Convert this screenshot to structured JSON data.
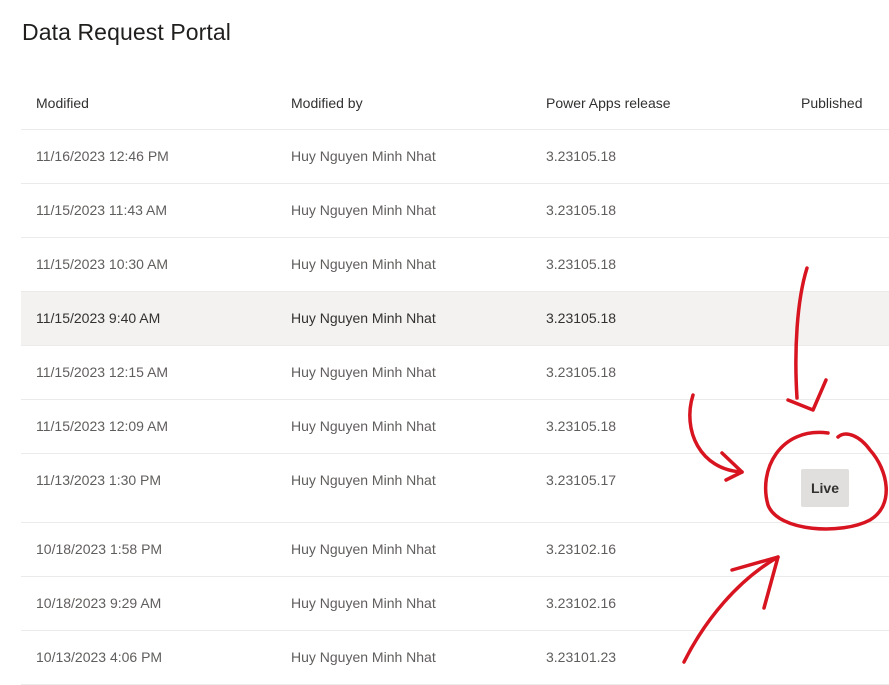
{
  "page": {
    "title": "Data Request Portal"
  },
  "table": {
    "columns": [
      "Modified",
      "Modified by",
      "Power Apps release",
      "Published"
    ],
    "rows": [
      {
        "modified": "11/16/2023 12:46 PM",
        "modified_by": "Huy Nguyen Minh Nhat",
        "release": "3.23105.18",
        "published": ""
      },
      {
        "modified": "11/15/2023 11:43 AM",
        "modified_by": "Huy Nguyen Minh Nhat",
        "release": "3.23105.18",
        "published": ""
      },
      {
        "modified": "11/15/2023 10:30 AM",
        "modified_by": "Huy Nguyen Minh Nhat",
        "release": "3.23105.18",
        "published": ""
      },
      {
        "modified": "11/15/2023 9:40 AM",
        "modified_by": "Huy Nguyen Minh Nhat",
        "release": "3.23105.18",
        "published": "",
        "selected": true
      },
      {
        "modified": "11/15/2023 12:15 AM",
        "modified_by": "Huy Nguyen Minh Nhat",
        "release": "3.23105.18",
        "published": ""
      },
      {
        "modified": "11/15/2023 12:09 AM",
        "modified_by": "Huy Nguyen Minh Nhat",
        "release": "3.23105.18",
        "published": ""
      },
      {
        "modified": "11/13/2023 1:30 PM",
        "modified_by": "Huy Nguyen Minh Nhat",
        "release": "3.23105.17",
        "published": "Live"
      },
      {
        "modified": "10/18/2023 1:58 PM",
        "modified_by": "Huy Nguyen Minh Nhat",
        "release": "3.23102.16",
        "published": ""
      },
      {
        "modified": "10/18/2023 9:29 AM",
        "modified_by": "Huy Nguyen Minh Nhat",
        "release": "3.23102.16",
        "published": ""
      },
      {
        "modified": "10/13/2023 4:06 PM",
        "modified_by": "Huy Nguyen Minh Nhat",
        "release": "3.23101.23",
        "published": ""
      }
    ]
  },
  "annotation": {
    "color": "#d7141f"
  }
}
